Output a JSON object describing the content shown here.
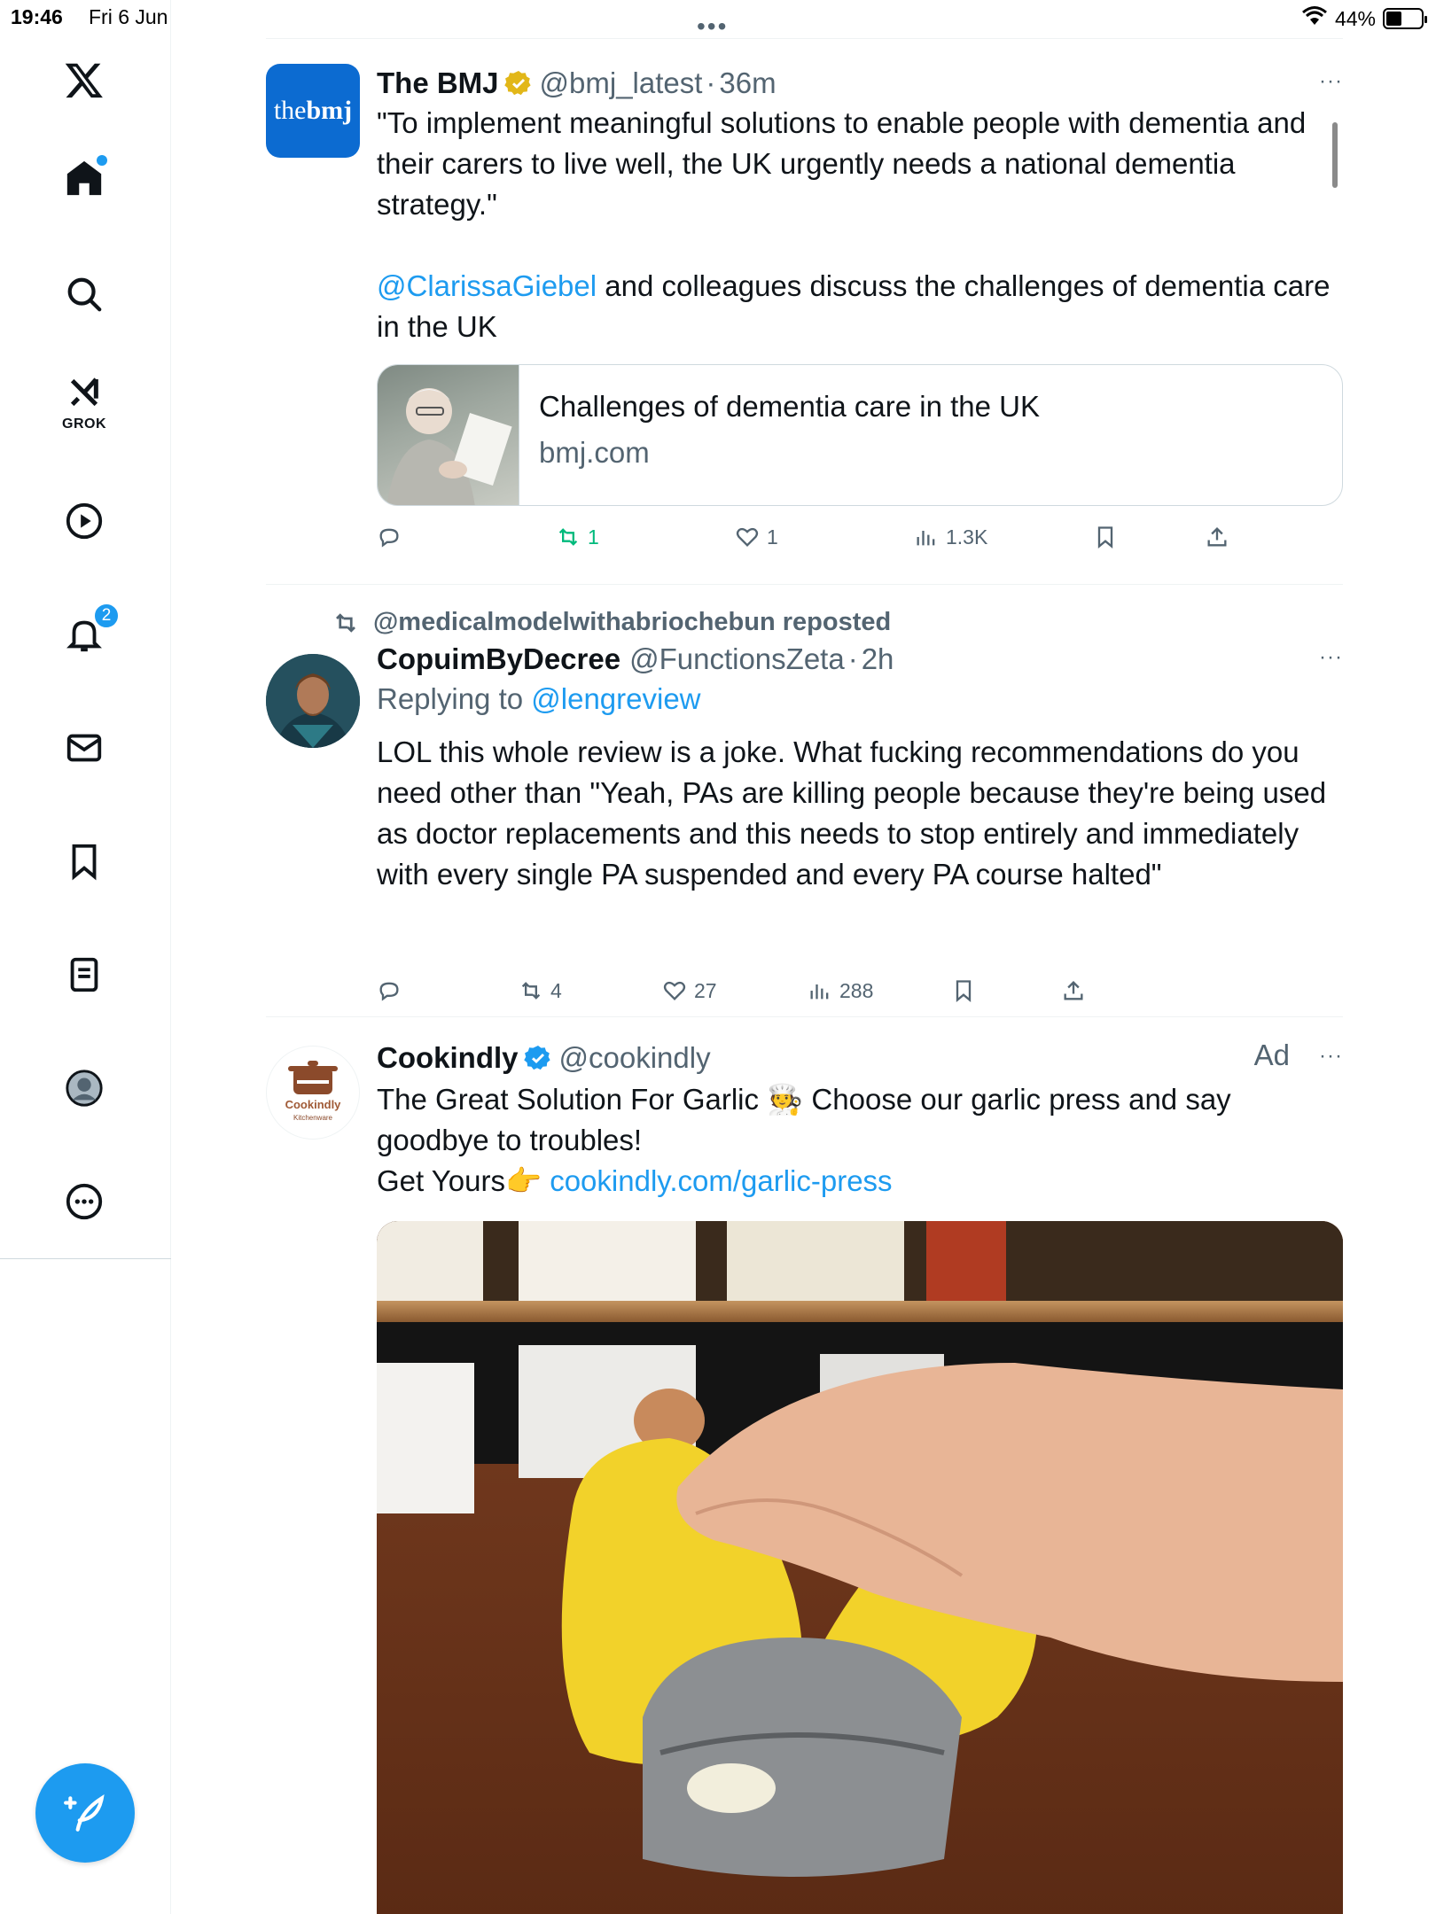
{
  "status_bar": {
    "time": "19:46",
    "date": "Fri 6 Jun",
    "battery": "44%",
    "battery_level": 0.44
  },
  "sidebar": {
    "grok_label": "GROK",
    "notifications_badge": "2"
  },
  "feed": {
    "top_dots": "•••",
    "tweets": [
      {
        "name": "The BMJ",
        "handle": "@bmj_latest",
        "dot": "·",
        "time": "36m",
        "more": "···",
        "avatar_text_a": "the",
        "avatar_text_b": "bmj",
        "text_1": "\"To implement meaningful solutions to enable people with dementia and their carers to live well, the UK urgently needs a national dementia strategy.\"",
        "mention": "@ClarissaGiebel",
        "text_2": " and colleagues discuss the challenges of dementia care in the UK",
        "card_title": "Challenges of dementia care in the UK",
        "card_domain": "bmj.com",
        "retweets": "1",
        "likes": "1",
        "views": "1.3K"
      },
      {
        "repost_label": "@medicalmodelwithabriochebun reposted",
        "name": "CopuimByDecree",
        "handle": "@FunctionsZeta",
        "dot": "·",
        "time": "2h",
        "more": "···",
        "replying_prefix": "Replying to ",
        "replying_to": "@lengreview",
        "text": "LOL this whole review is a joke. What fucking recommendations do you need other than \"Yeah, PAs are killing people because they're being used as doctor replacements and this needs to stop entirely and immediately with every single PA suspended and every PA course halted\"",
        "retweets": "4",
        "likes": "27",
        "views": "288"
      },
      {
        "name": "Cookindly",
        "handle": "@cookindly",
        "ad_label": "Ad",
        "more": "···",
        "avatar_text": "Cookindly",
        "avatar_subtext": "Kitchenware",
        "text_1": "The Great Solution For Garlic 🧑‍🍳 Choose our garlic press and say goodbye to troubles!",
        "text_2": "Get Yours👉 ",
        "link": "cookindly.com/garlic-press"
      }
    ]
  },
  "colors": {
    "accent": "#1d9bf0",
    "retweet_active": "#00ba7c",
    "muted": "#536471",
    "gold_check": "#e2b719"
  }
}
